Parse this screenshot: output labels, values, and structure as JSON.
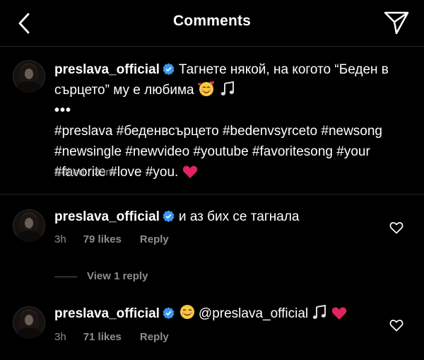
{
  "header": {
    "title": "Comments"
  },
  "caption": {
    "username": "preslava_official",
    "text": "Тагнете някой, на когото “Беден в сърцето” му е любима",
    "more": "•••",
    "hashtags": "#preslava #беденвсърцето #bedenvsyrceto #newsong #newsingle #newvideo #youtube #favoritesong #your #favorite #love #you.",
    "edited": "Edited · 39m"
  },
  "comments": [
    {
      "username": "preslava_official",
      "text": "и аз бих се тагнала",
      "time": "3h",
      "likes": "79 likes",
      "reply": "Reply",
      "view_replies": "View 1 reply"
    },
    {
      "username": "preslava_official",
      "text": "@preslava_official",
      "time": "3h",
      "likes": "71 likes",
      "reply": "Reply"
    }
  ],
  "colors": {
    "background": "#000000",
    "muted": "#8e8e8e",
    "verified": "#3897f0",
    "heart": "#e0245e"
  },
  "icons": [
    "back-icon",
    "send-icon",
    "verified-icon",
    "heart-icon",
    "smiling-face-hearts-emoji",
    "music-notes-emoji",
    "red-heart-emoji",
    "smiling-face-closed-eyes-emoji"
  ]
}
